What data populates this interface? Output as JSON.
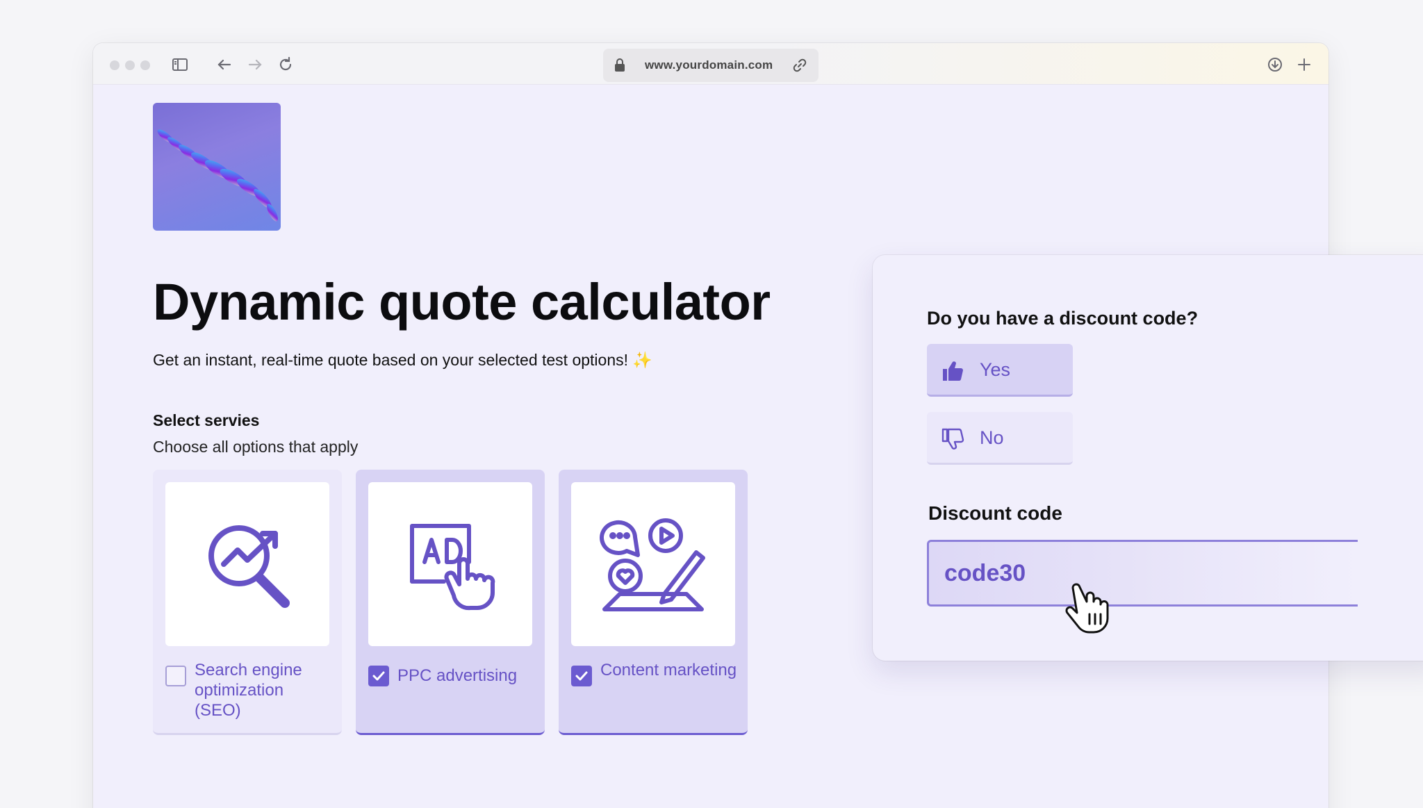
{
  "browser": {
    "url": "www.yourdomain.com"
  },
  "page": {
    "title": "Dynamic quote calculator",
    "subtitle": "Get an instant, real-time quote based on your selected test options!",
    "subtitle_emoji": "✨",
    "section_label": "Select servies",
    "section_help": "Choose all options that apply"
  },
  "services": [
    {
      "label": "Search engine optimization (SEO)",
      "checked": false,
      "icon": "seo-magnifier-icon"
    },
    {
      "label": "PPC advertising",
      "checked": true,
      "icon": "ad-click-icon"
    },
    {
      "label": "Content marketing",
      "checked": true,
      "icon": "content-marketing-icon"
    }
  ],
  "discount": {
    "question": "Do you have a discount code?",
    "yes_label": "Yes",
    "no_label": "No",
    "selected": "Yes",
    "code_label": "Discount code",
    "code_value": "code30"
  },
  "colors": {
    "accent": "#6652c5",
    "page_bg": "#f1effc",
    "card_selected": "#d8d3f4"
  }
}
